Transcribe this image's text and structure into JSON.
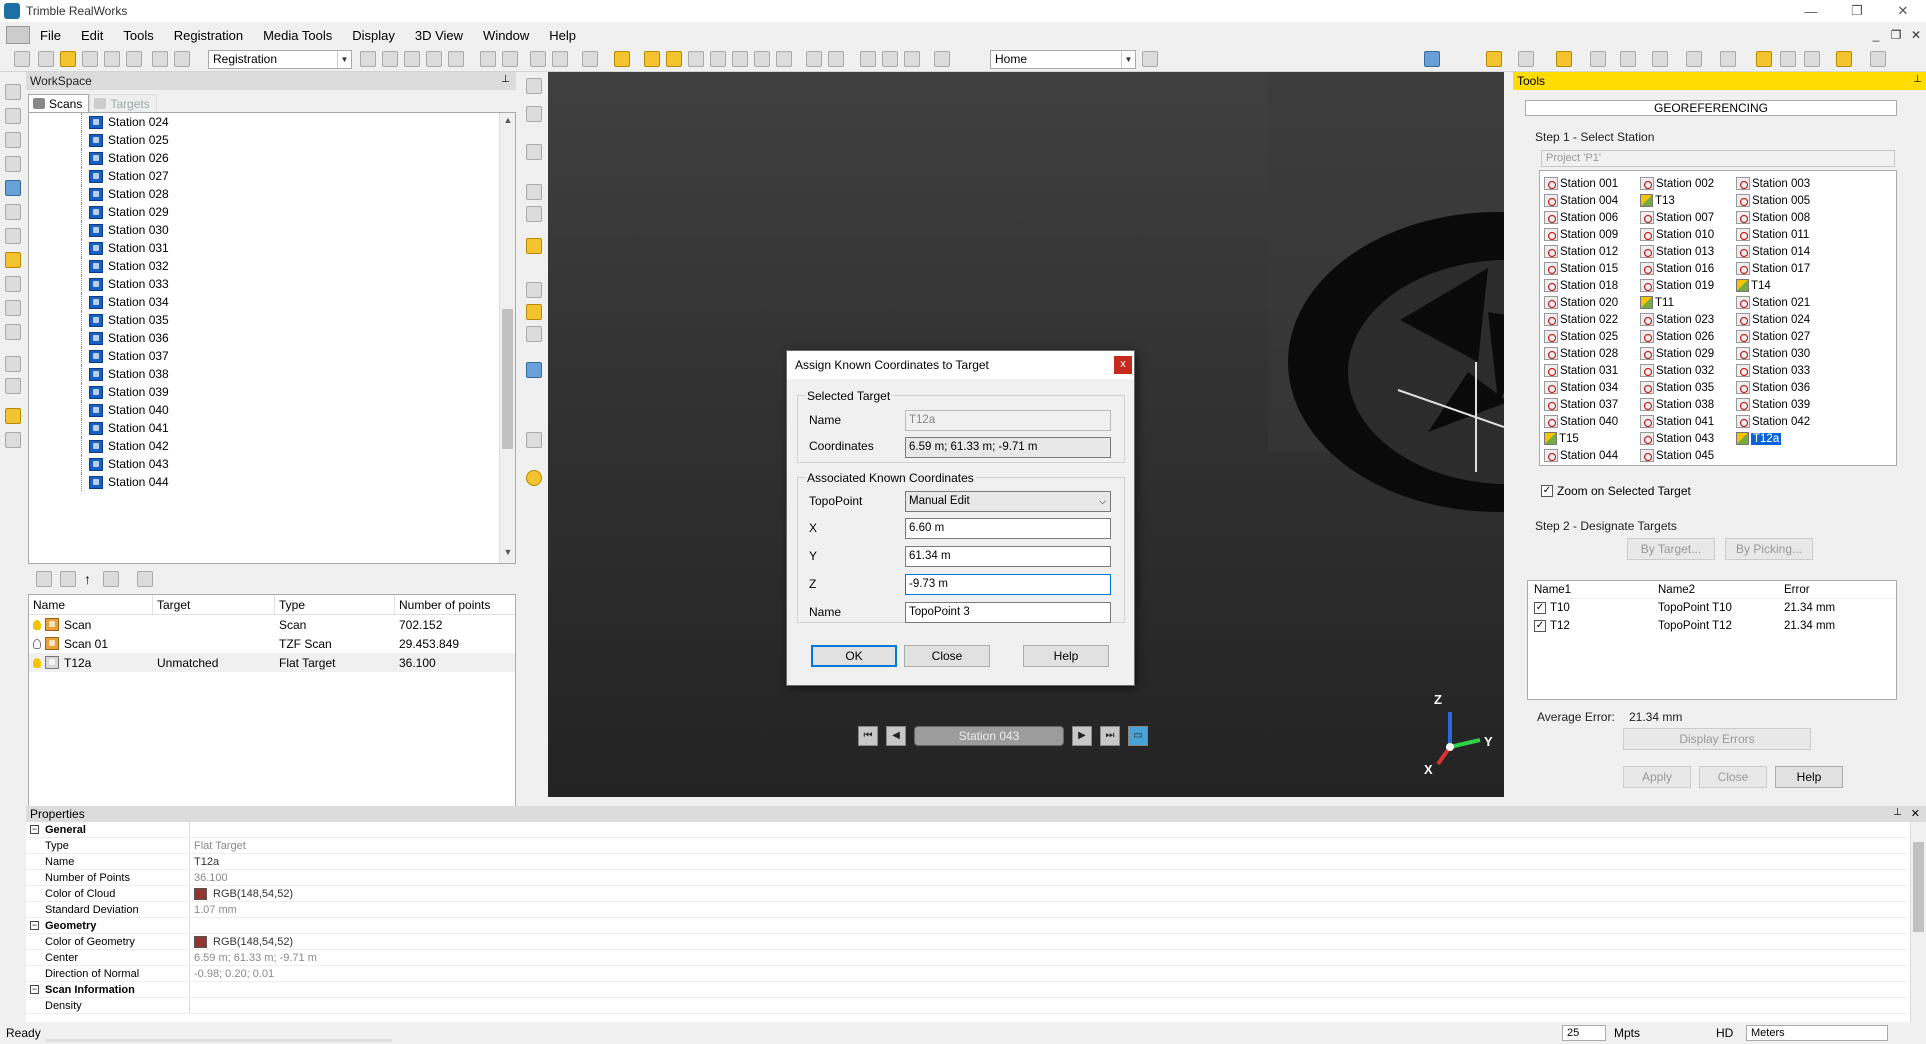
{
  "window": {
    "title": "Trimble RealWorks"
  },
  "menu": [
    "File",
    "Edit",
    "Tools",
    "Registration",
    "Media Tools",
    "Display",
    "3D View",
    "Window",
    "Help"
  ],
  "toolbar": {
    "mode_combo": "Registration",
    "view_combo": "Home"
  },
  "workspace": {
    "title": "WorkSpace",
    "tabs": [
      "Scans",
      "Targets"
    ],
    "tree_items": [
      "Station 024",
      "Station 025",
      "Station 026",
      "Station 027",
      "Station 028",
      "Station 029",
      "Station 030",
      "Station 031",
      "Station 032",
      "Station 033",
      "Station 034",
      "Station 035",
      "Station 036",
      "Station 037",
      "Station 038",
      "Station 039",
      "Station 040",
      "Station 041",
      "Station 042",
      "Station 043",
      "Station 044"
    ],
    "list_headers": [
      "Name",
      "Target",
      "Type",
      "Number of points"
    ],
    "list_rows": [
      {
        "name": "Scan",
        "target": "",
        "type": "Scan",
        "points": "702.152"
      },
      {
        "name": "Scan 01",
        "target": "",
        "type": "TZF Scan",
        "points": "29.453.849"
      },
      {
        "name": "T12a",
        "target": "Unmatched",
        "type": "Flat Target",
        "points": "36.100"
      }
    ]
  },
  "viewport": {
    "station_label": "Station 043",
    "axis_x": "X",
    "axis_y": "Y",
    "axis_z": "Z"
  },
  "dialog": {
    "title": "Assign Known Coordinates to Target",
    "close_x": "x",
    "selected_target_label": "Selected Target",
    "name_label": "Name",
    "name_value": "T12a",
    "coords_label": "Coordinates",
    "coords_value": "6.59 m; 61.33 m; -9.71 m",
    "assoc_label": "Associated Known Coordinates",
    "topopoint_label": "TopoPoint",
    "topopoint_value": "Manual Edit",
    "x_label": "X",
    "x_value": "6.60 m",
    "y_label": "Y",
    "y_value": "61.34 m",
    "z_label": "Z",
    "z_value": "-9.73 m",
    "name2_label": "Name",
    "name2_value": "TopoPoint 3",
    "ok": "OK",
    "close": "Close",
    "help": "Help"
  },
  "tools": {
    "title": "Tools",
    "header": "GEOREFERENCING",
    "step1": "Step 1 - Select Station",
    "project": "Project 'P1'",
    "stations": [
      [
        "Station 001",
        "Station 002",
        "Station 003"
      ],
      [
        "Station 004",
        "T13",
        "Station 005"
      ],
      [
        "Station 006",
        "Station 007",
        "Station 008"
      ],
      [
        "Station 009",
        "Station 010",
        "Station 011"
      ],
      [
        "Station 012",
        "Station 013",
        "Station 014"
      ],
      [
        "Station 015",
        "Station 016",
        "Station 017"
      ],
      [
        "Station 018",
        "Station 019",
        "T14"
      ],
      [
        "Station 020",
        "T11",
        "Station 021"
      ],
      [
        "Station 022",
        "Station 023",
        "Station 024"
      ],
      [
        "Station 025",
        "Station 026",
        "Station 027"
      ],
      [
        "Station 028",
        "Station 029",
        "Station 030"
      ],
      [
        "Station 031",
        "Station 032",
        "Station 033"
      ],
      [
        "Station 034",
        "Station 035",
        "Station 036"
      ],
      [
        "Station 037",
        "Station 038",
        "Station 039"
      ],
      [
        "Station 040",
        "Station 041",
        "Station 042"
      ],
      [
        "T15",
        "Station 043",
        "T12a"
      ],
      [
        "Station 044",
        "Station 045",
        ""
      ]
    ],
    "zoom_label": "Zoom on Selected Target",
    "step2": "Step 2 - Designate Targets",
    "by_target": "By Target...",
    "by_picking": "By Picking...",
    "err_headers": [
      "Name1",
      "Name2",
      "Error"
    ],
    "err_rows": [
      {
        "n1": "T10",
        "n2": "TopoPoint T10",
        "err": "21.34 mm"
      },
      {
        "n1": "T12",
        "n2": "TopoPoint T12",
        "err": "21.34 mm"
      }
    ],
    "avg_label": "Average Error:",
    "avg_value": "21.34 mm",
    "display_errors": "Display Errors",
    "apply": "Apply",
    "close": "Close",
    "help": "Help"
  },
  "properties": {
    "title": "Properties",
    "rows": [
      {
        "group": "General"
      },
      {
        "k": "Type",
        "v": "Flat Target",
        "g": true
      },
      {
        "k": "Name",
        "v": "T12a"
      },
      {
        "k": "Number of Points",
        "v": "36.100",
        "g": true
      },
      {
        "k": "Color of Cloud",
        "v": "RGB(148,54,52)",
        "swatch": true
      },
      {
        "k": "Standard Deviation",
        "v": "1.07 mm",
        "g": true
      },
      {
        "group": "Geometry"
      },
      {
        "k": "Color of Geometry",
        "v": "RGB(148,54,52)",
        "swatch": true
      },
      {
        "k": "Center",
        "v": "6.59 m; 61.33 m; -9.71 m",
        "g": true
      },
      {
        "k": "Direction of Normal",
        "v": "-0.98; 0.20; 0.01",
        "g": true
      },
      {
        "group": "Scan Information"
      },
      {
        "k": "Density",
        "v": ""
      }
    ]
  },
  "status": {
    "ready": "Ready",
    "points_value": "25",
    "points_unit": "Mpts",
    "hd": "HD",
    "units": "Meters"
  },
  "colors": {
    "accent": "#ffdd00",
    "selection": "#0a64d8",
    "swatch": "#94362f"
  }
}
